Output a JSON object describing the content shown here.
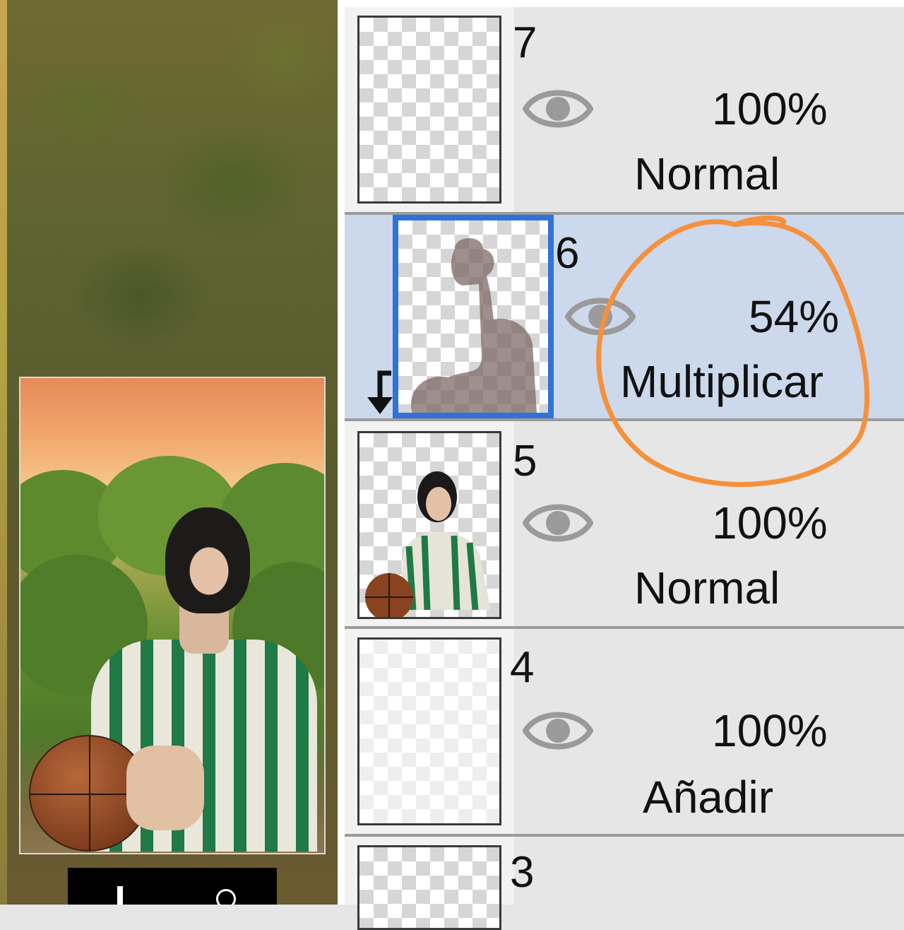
{
  "layers": [
    {
      "number": "7",
      "opacity": "100%",
      "blend": "Normal",
      "visible_icon": "eye-icon"
    },
    {
      "number": "6",
      "opacity": "54%",
      "blend": "Multiplicar",
      "visible_icon": "eye-icon",
      "selected": true,
      "clipping": true
    },
    {
      "number": "5",
      "opacity": "100%",
      "blend": "Normal",
      "visible_icon": "eye-icon"
    },
    {
      "number": "4",
      "opacity": "100%",
      "blend": "Añadir",
      "visible_icon": "eye-icon"
    },
    {
      "number": "3"
    }
  ],
  "colors": {
    "selected_row": "#ccd8ec",
    "selected_thumb_border": "#2f73d8",
    "annotation": "#f5913c",
    "eye": "#9a9a9a"
  }
}
